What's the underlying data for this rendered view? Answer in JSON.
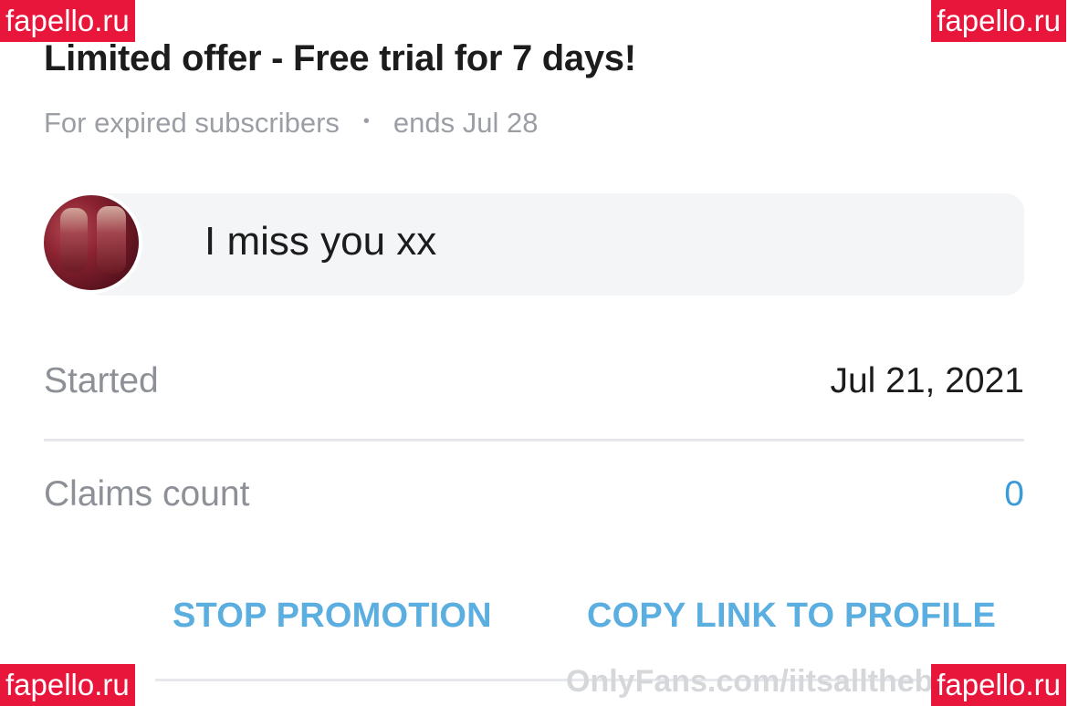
{
  "offer": {
    "title": "Limited offer - Free trial for 7 days!",
    "audience": "For expired subscribers",
    "separator": "•",
    "ends": "ends Jul 28"
  },
  "message": {
    "text": "I miss you xx"
  },
  "details": {
    "started_label": "Started",
    "started_value": "Jul 21, 2021",
    "claims_label": "Claims count",
    "claims_value": "0"
  },
  "actions": {
    "stop_label": "STOP PROMOTION",
    "copy_label": "COPY LINK TO PROFILE"
  },
  "watermarks": {
    "top_left": "fapello.ru",
    "top_right": "fapello.ru",
    "bottom_left": "fapello.ru",
    "bottom_right": "fapello.ru",
    "footer": "OnlyFans.com/iitsallthebl"
  },
  "colors": {
    "accent": "#3a9bd6",
    "action": "#5aaee0",
    "watermark_bg": "#e8163b"
  }
}
